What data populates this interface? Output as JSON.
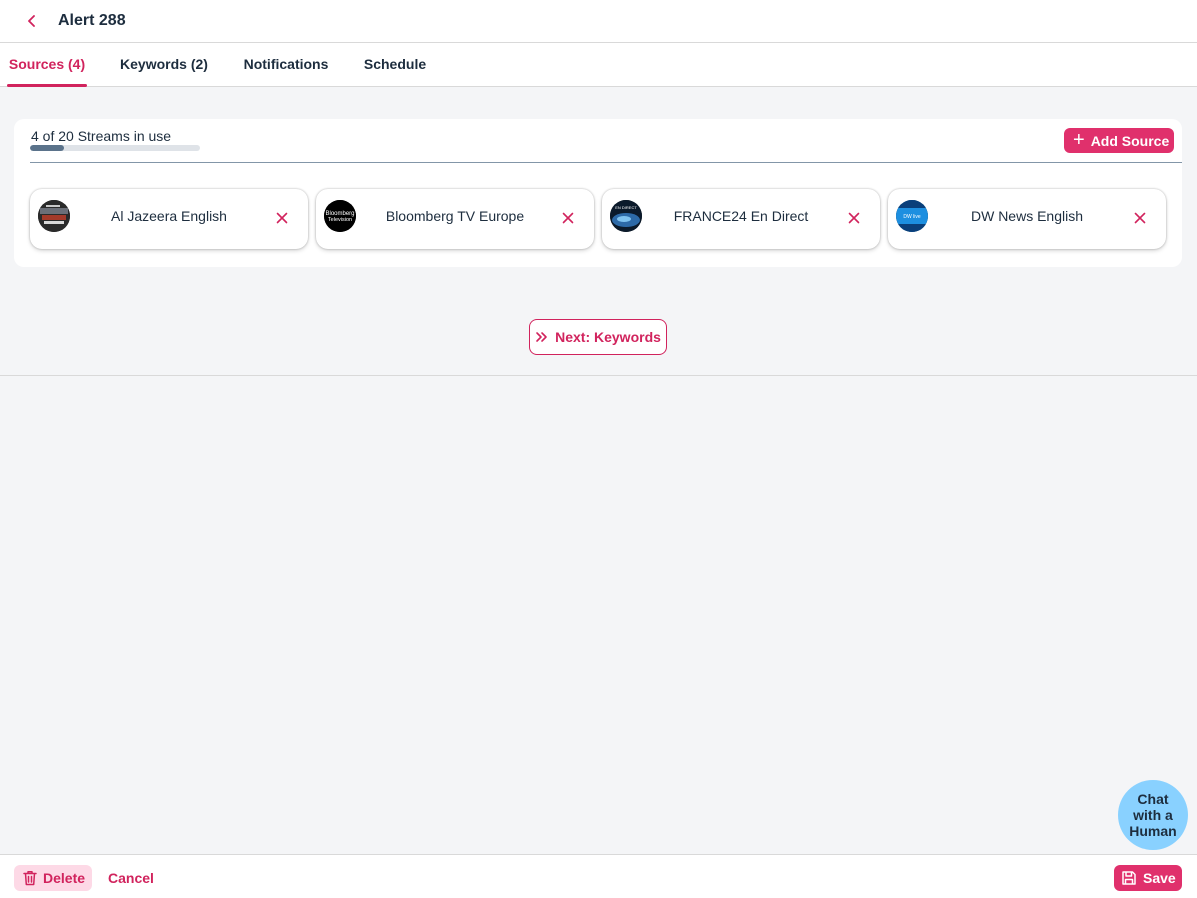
{
  "header": {
    "title": "Alert 288",
    "back_icon": "chevron-left-icon"
  },
  "tabs": [
    {
      "label": "Sources (4)",
      "active": true
    },
    {
      "label": "Keywords (2)",
      "active": false
    },
    {
      "label": "Notifications",
      "active": false
    },
    {
      "label": "Schedule",
      "active": false
    }
  ],
  "sources": {
    "usage_text": "4 of 20 Streams in use",
    "usage_fraction": 0.2,
    "add_label": "Add Source",
    "items": [
      {
        "name": "Al Jazeera English",
        "logo_text": ""
      },
      {
        "name": "Bloomberg TV Europe",
        "logo_text": "Bloomberg Television"
      },
      {
        "name": "FRANCE24 En Direct",
        "logo_text": "EN DIRECT"
      },
      {
        "name": "DW News English",
        "logo_text": "DW live"
      }
    ]
  },
  "next_button": {
    "label": "Next: Keywords"
  },
  "chat": {
    "line1": "Chat",
    "line2": "with a",
    "line3": "Human"
  },
  "footer": {
    "delete_label": "Delete",
    "cancel_label": "Cancel",
    "save_label": "Save"
  },
  "colors": {
    "accent": "#d1235d",
    "accent_button": "#e0306c",
    "chat_bubble": "#89d1ff",
    "progress": "#5b738b"
  }
}
